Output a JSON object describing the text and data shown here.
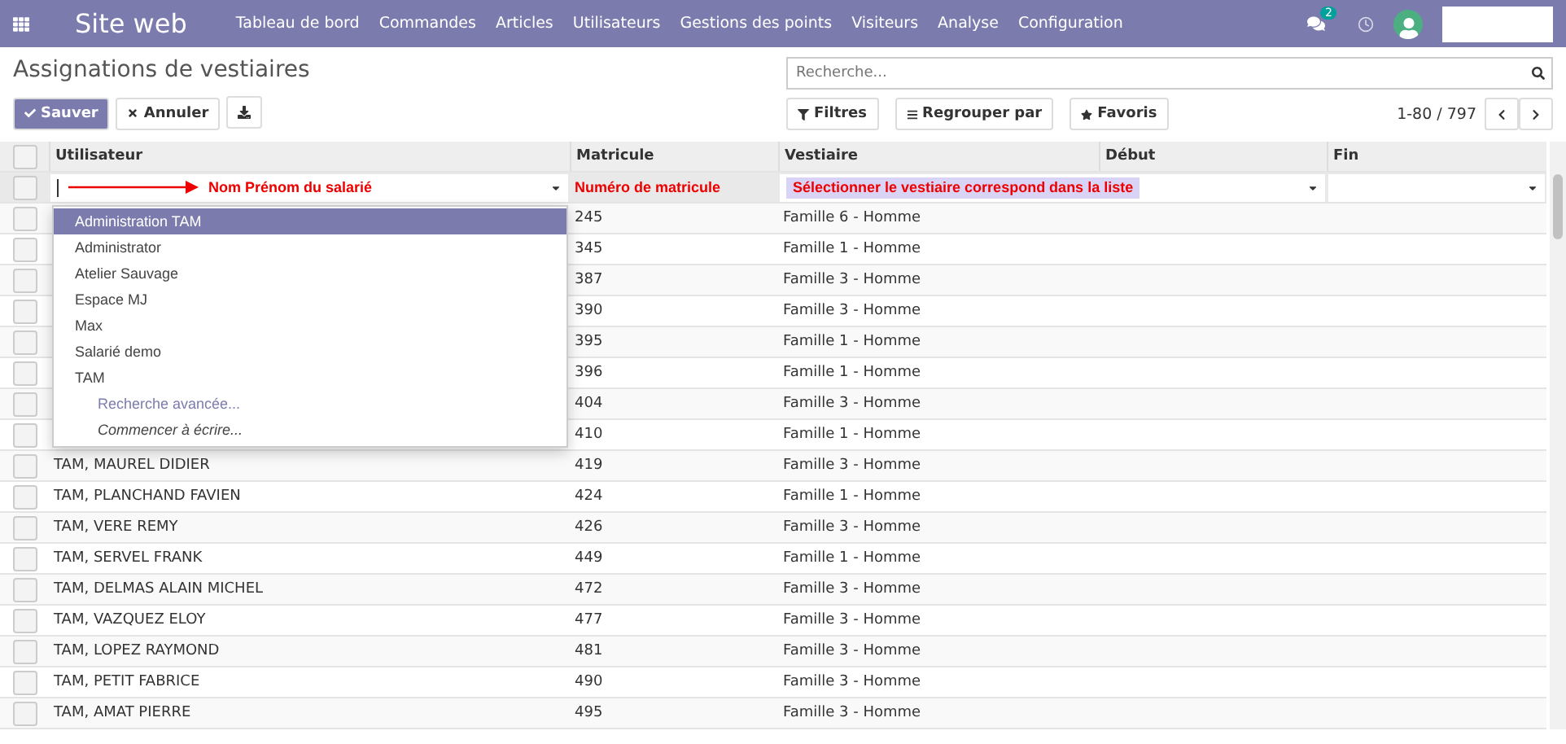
{
  "navbar": {
    "app_title": "Site web",
    "menu": [
      "Tableau de bord",
      "Commandes",
      "Articles",
      "Utilisateurs",
      "Gestions des points",
      "Visiteurs",
      "Analyse",
      "Configuration"
    ],
    "message_count": "2"
  },
  "page_title": "Assignations de vestiaires",
  "buttons": {
    "save": "Sauver",
    "cancel": "Annuler"
  },
  "search": {
    "placeholder": "Recherche..."
  },
  "filters": [
    "Filtres",
    "Regrouper par",
    "Favoris"
  ],
  "pager": "1-80 / 797",
  "table": {
    "select_all_checked": false,
    "columns": [
      "Utilisateur",
      "Matricule",
      "Vestiaire",
      "Début",
      "Fin"
    ],
    "edit_row": {
      "checked": false,
      "user_note": "Nom Prénom du salarié",
      "matricule_note": "Numéro de matricule",
      "vestiaire_note": "Sélectionner le vestiaire correspond dans la liste"
    },
    "rows": [
      {
        "checked": false,
        "matricule": "245",
        "vestiaire": "Famille 6 - Homme"
      },
      {
        "checked": false,
        "matricule": "345",
        "vestiaire": "Famille 1 - Homme"
      },
      {
        "checked": false,
        "matricule": "387",
        "vestiaire": "Famille 3 - Homme"
      },
      {
        "checked": false,
        "matricule": "390",
        "vestiaire": "Famille 3 - Homme"
      },
      {
        "checked": false,
        "matricule": "395",
        "vestiaire": "Famille 1 - Homme"
      },
      {
        "checked": false,
        "matricule": "396",
        "vestiaire": "Famille 1 - Homme"
      },
      {
        "checked": false,
        "matricule": "404",
        "vestiaire": "Famille 3 - Homme"
      },
      {
        "checked": false,
        "matricule": "410",
        "vestiaire": "Famille 1 - Homme"
      },
      {
        "checked": false,
        "user": "TAM, MAUREL DIDIER",
        "matricule": "419",
        "vestiaire": "Famille 3 - Homme"
      },
      {
        "checked": false,
        "user": "TAM, PLANCHAND FAVIEN",
        "matricule": "424",
        "vestiaire": "Famille 1 - Homme"
      },
      {
        "checked": false,
        "user": "TAM, VERE REMY",
        "matricule": "426",
        "vestiaire": "Famille 3 - Homme"
      },
      {
        "checked": false,
        "user": "TAM, SERVEL FRANK",
        "matricule": "449",
        "vestiaire": "Famille 1 - Homme"
      },
      {
        "checked": false,
        "user": "TAM, DELMAS ALAIN MICHEL",
        "matricule": "472",
        "vestiaire": "Famille 3 - Homme"
      },
      {
        "checked": false,
        "user": "TAM, VAZQUEZ ELOY",
        "matricule": "477",
        "vestiaire": "Famille 3 - Homme"
      },
      {
        "checked": false,
        "user": "TAM, LOPEZ RAYMOND",
        "matricule": "481",
        "vestiaire": "Famille 3 - Homme"
      },
      {
        "checked": false,
        "user": "TAM, PETIT FABRICE",
        "matricule": "490",
        "vestiaire": "Famille 3 - Homme"
      },
      {
        "checked": false,
        "user": "TAM, AMAT PIERRE",
        "matricule": "495",
        "vestiaire": "Famille 3 - Homme"
      }
    ]
  },
  "dropdown": {
    "options": [
      {
        "label": "Administration TAM",
        "selected": true
      },
      {
        "label": "Administrator",
        "selected": false
      },
      {
        "label": "Atelier Sauvage",
        "selected": false
      },
      {
        "label": "Espace MJ",
        "selected": false
      },
      {
        "label": "Max",
        "selected": false
      },
      {
        "label": "Salarié demo",
        "selected": false
      },
      {
        "label": "TAM",
        "selected": false
      }
    ],
    "links": [
      {
        "kind": "link",
        "label": "Recherche avancée..."
      },
      {
        "kind": "hint",
        "label": "Commencer à écrire..."
      }
    ]
  }
}
